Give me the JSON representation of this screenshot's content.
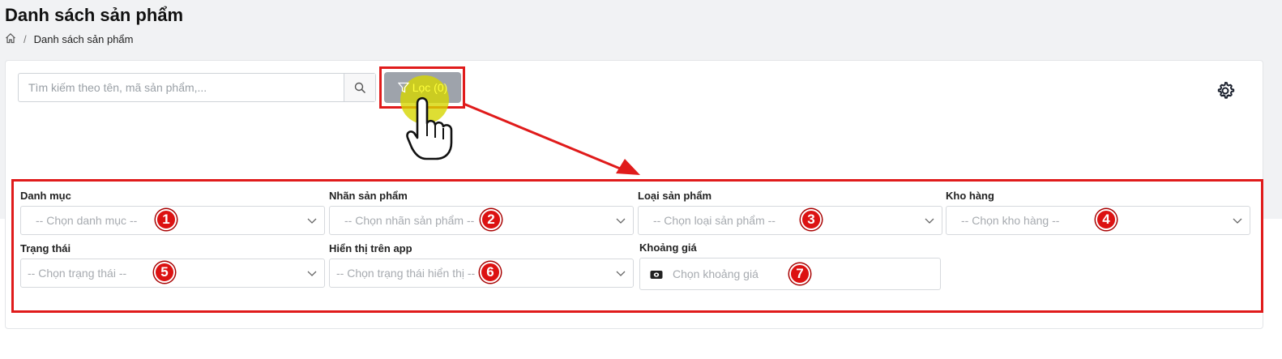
{
  "header": {
    "title": "Danh sách sản phẩm"
  },
  "breadcrumb": {
    "home_icon": "home-icon",
    "separator": "/",
    "current": "Danh sách sản phẩm"
  },
  "search": {
    "placeholder": "Tìm kiếm theo tên, mã sản phẩm,...",
    "icon": "search-icon"
  },
  "filter_button": {
    "label": "Lọc (0)",
    "icon": "filter-icon"
  },
  "settings": {
    "icon": "gear-icon"
  },
  "filters": {
    "category": {
      "label": "Danh mục",
      "placeholder": "-- Chọn danh mục --",
      "step": "1"
    },
    "product_tag": {
      "label": "Nhãn sản phẩm",
      "placeholder": "-- Chọn nhãn sản phẩm --",
      "step": "2"
    },
    "product_type": {
      "label": "Loại sản phẩm",
      "placeholder": "-- Chọn loại sản phẩm --",
      "step": "3"
    },
    "warehouse": {
      "label": "Kho hàng",
      "placeholder": "-- Chọn kho hàng --",
      "step": "4"
    },
    "status": {
      "label": "Trạng thái",
      "placeholder": "-- Chọn trạng thái --",
      "step": "5"
    },
    "app_display": {
      "label": "Hiển thị trên app",
      "placeholder": "-- Chọn trạng thái hiển thị --",
      "step": "6"
    },
    "price_range": {
      "label": "Khoảng giá",
      "placeholder": "Chọn khoảng giá",
      "step": "7",
      "icon": "money-icon"
    }
  },
  "colors": {
    "highlight": "#e01b1b",
    "badge": "#dc1212",
    "filter_button": "#9ea3ab",
    "cursor_spot": "#d6d600"
  }
}
